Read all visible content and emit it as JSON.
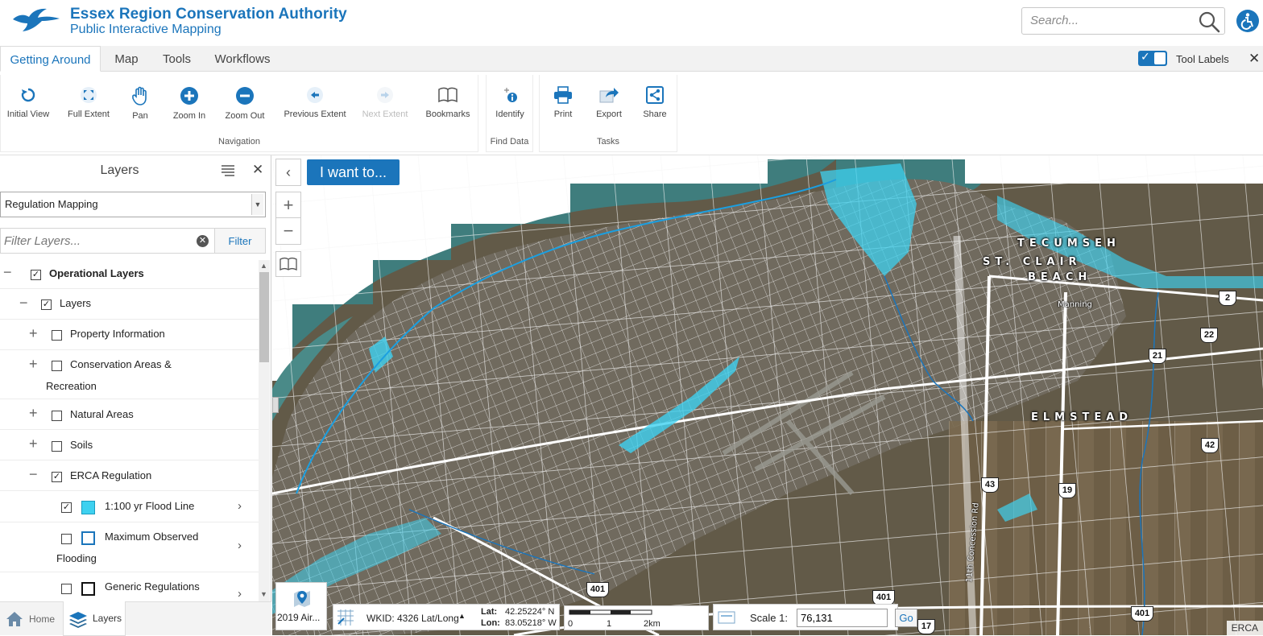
{
  "header": {
    "org_title": "Essex Region Conservation Authority",
    "org_subtitle": "Public Interactive Mapping",
    "search_placeholder": "Search...",
    "accent_color": "#1b75bb"
  },
  "tabs": [
    {
      "label": "Getting Around",
      "active": true
    },
    {
      "label": "Map",
      "active": false
    },
    {
      "label": "Tools",
      "active": false
    },
    {
      "label": "Workflows",
      "active": false
    }
  ],
  "tool_labels": {
    "label": "Tool Labels",
    "checked": true
  },
  "toolbar": {
    "navigation": {
      "label": "Navigation",
      "tools": [
        {
          "label": "Initial View",
          "icon": "initial-view-icon"
        },
        {
          "label": "Full Extent",
          "icon": "full-extent-icon"
        },
        {
          "label": "Pan",
          "icon": "hand-icon"
        },
        {
          "label": "Zoom In",
          "icon": "zoom-in-icon"
        },
        {
          "label": "Zoom Out",
          "icon": "zoom-out-icon"
        },
        {
          "label": "Previous Extent",
          "icon": "previous-extent-icon"
        },
        {
          "label": "Next Extent",
          "icon": "next-extent-icon",
          "disabled": true
        },
        {
          "label": "Bookmarks",
          "icon": "bookmarks-icon"
        }
      ]
    },
    "find_data": {
      "label": "Find Data",
      "tools": [
        {
          "label": "Identify",
          "icon": "identify-icon"
        }
      ]
    },
    "tasks": {
      "label": "Tasks",
      "tools": [
        {
          "label": "Print",
          "icon": "print-icon"
        },
        {
          "label": "Export",
          "icon": "export-icon"
        },
        {
          "label": "Share",
          "icon": "share-icon"
        }
      ]
    }
  },
  "layers_panel": {
    "title": "Layers",
    "selected_theme": "Regulation Mapping",
    "filter_placeholder": "Filter Layers...",
    "filter_button": "Filter",
    "tree": {
      "operational": {
        "label": "Operational Layers",
        "checked": true,
        "expanded": true
      },
      "layers": {
        "label": "Layers",
        "checked": true,
        "expanded": true
      },
      "property": {
        "label": "Property Information",
        "checked": false
      },
      "conservation": {
        "label_line1": "Conservation Areas &",
        "label_line2": "Recreation",
        "checked": false
      },
      "natural": {
        "label": "Natural Areas",
        "checked": false
      },
      "soils": {
        "label": "Soils",
        "checked": false
      },
      "erca": {
        "label": "ERCA Regulation",
        "checked": true,
        "expanded": true
      },
      "flood_line": {
        "label": "1:100 yr Flood Line",
        "checked": true,
        "swatch_fill": "#3ed1f0"
      },
      "max_flood": {
        "label_line1": "Maximum Observed",
        "label_line2": "Flooding",
        "checked": false,
        "swatch_border": "#1b75bb"
      },
      "generic": {
        "label": "Generic Regulations",
        "checked": false,
        "swatch_border": "#111111"
      }
    },
    "panel_tabs": {
      "home": "Home",
      "layers": "Layers"
    }
  },
  "map": {
    "i_want_to": "I want to...",
    "basemap_label": "2019 Air...",
    "wkid": "WKID: 4326 Lat/Long",
    "lat_label": "Lat:",
    "lat_value": "42.25224° N",
    "lon_label": "Lon:",
    "lon_value": "83.05218° W",
    "scalebar_ticks": [
      "0",
      "1",
      "2km"
    ],
    "scale_label": "Scale 1:",
    "scale_value": "76,131",
    "go_label": "Go",
    "attribution": "ERCA",
    "places": {
      "tecumseh": "TECUMSEH",
      "st_clair": "ST. CLAIR",
      "beach": "BEACH",
      "manning": "Manning",
      "elmstead": "ELMSTEAD",
      "concession": "11th Concession Rd"
    },
    "shields": [
      "2",
      "22",
      "21",
      "42",
      "43",
      "19",
      "401",
      "401",
      "401",
      "17"
    ]
  }
}
